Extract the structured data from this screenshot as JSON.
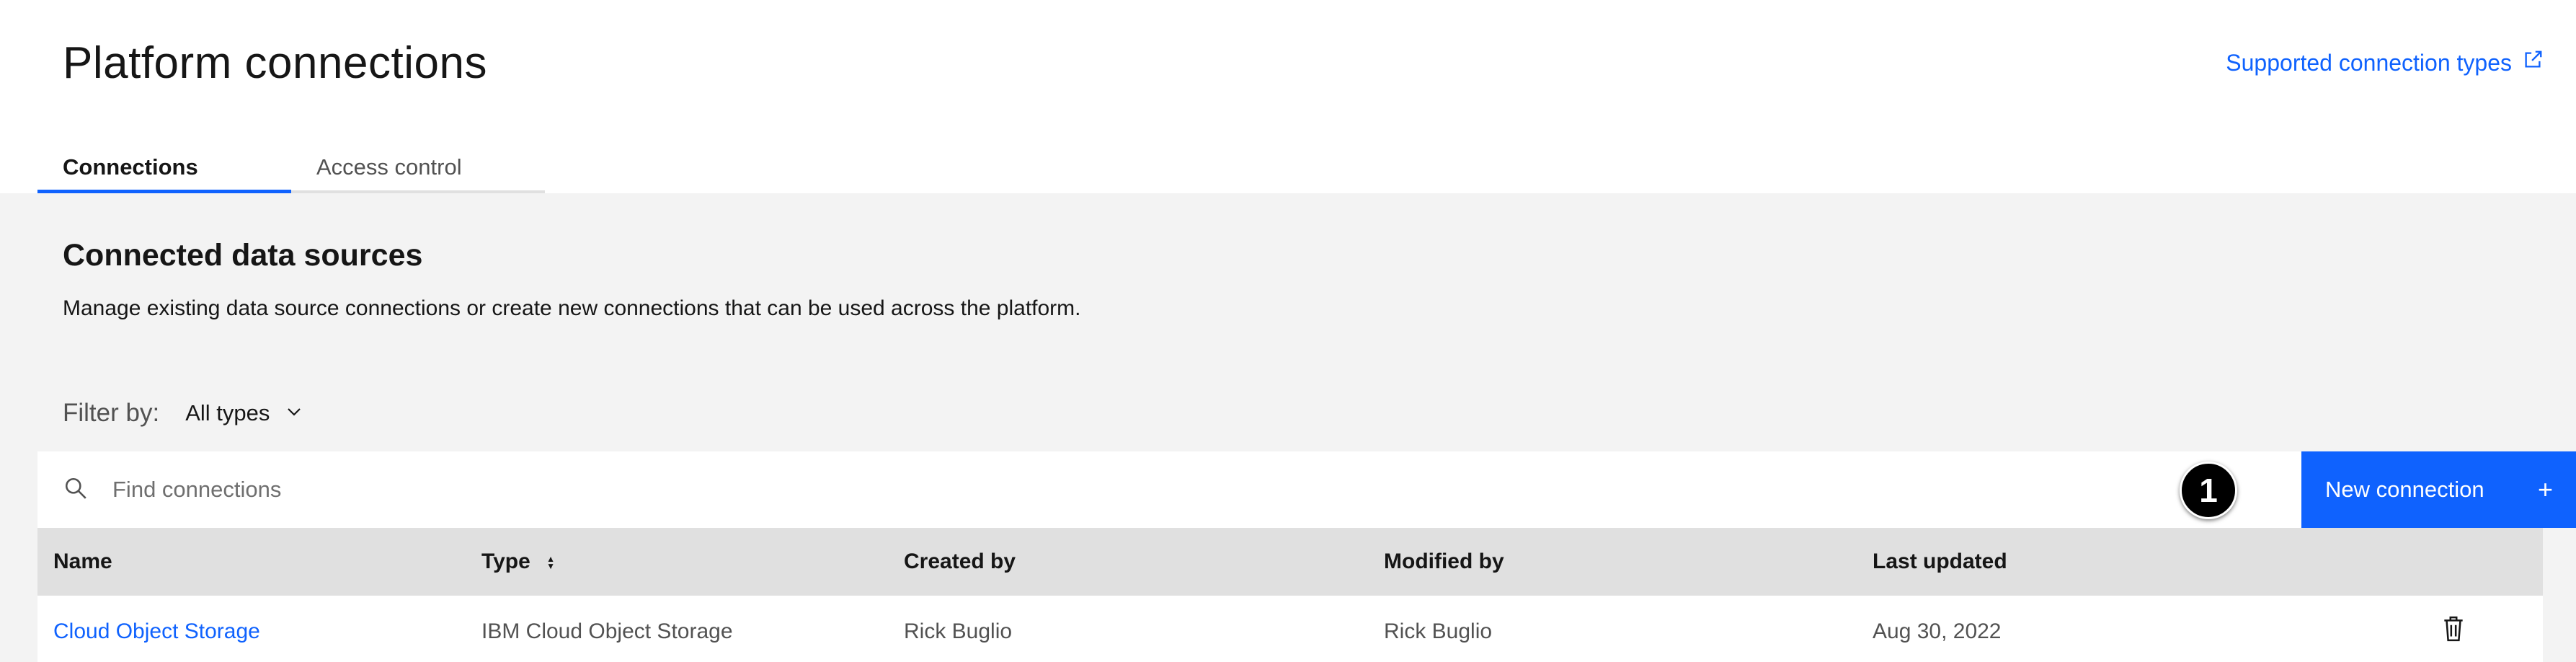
{
  "header": {
    "title": "Platform connections",
    "ext_link_label": "Supported connection types",
    "ext_link_icon": "launch-icon"
  },
  "tabs": [
    {
      "label": "Connections",
      "active": true
    },
    {
      "label": "Access control",
      "active": false
    }
  ],
  "section": {
    "title": "Connected data sources",
    "description": "Manage existing data source connections or create new connections that can be used across the platform."
  },
  "filter": {
    "label": "Filter by:",
    "value": "All types"
  },
  "search": {
    "placeholder": "Find connections",
    "value": ""
  },
  "callout_badge": "1",
  "new_button": {
    "label": "New connection",
    "icon": "+"
  },
  "table": {
    "headers": [
      "Name",
      "Type",
      "Created by",
      "Modified by",
      "Last updated"
    ],
    "rows": [
      {
        "name": "Cloud Object Storage",
        "type": "IBM Cloud Object Storage",
        "created_by": "Rick Buglio",
        "modified_by": "Rick Buglio",
        "last_updated": "Aug 30, 2022"
      }
    ]
  },
  "colors": {
    "accent": "#0f62fe",
    "background": "#f3f3f3",
    "header_row": "#e0e0e0"
  }
}
